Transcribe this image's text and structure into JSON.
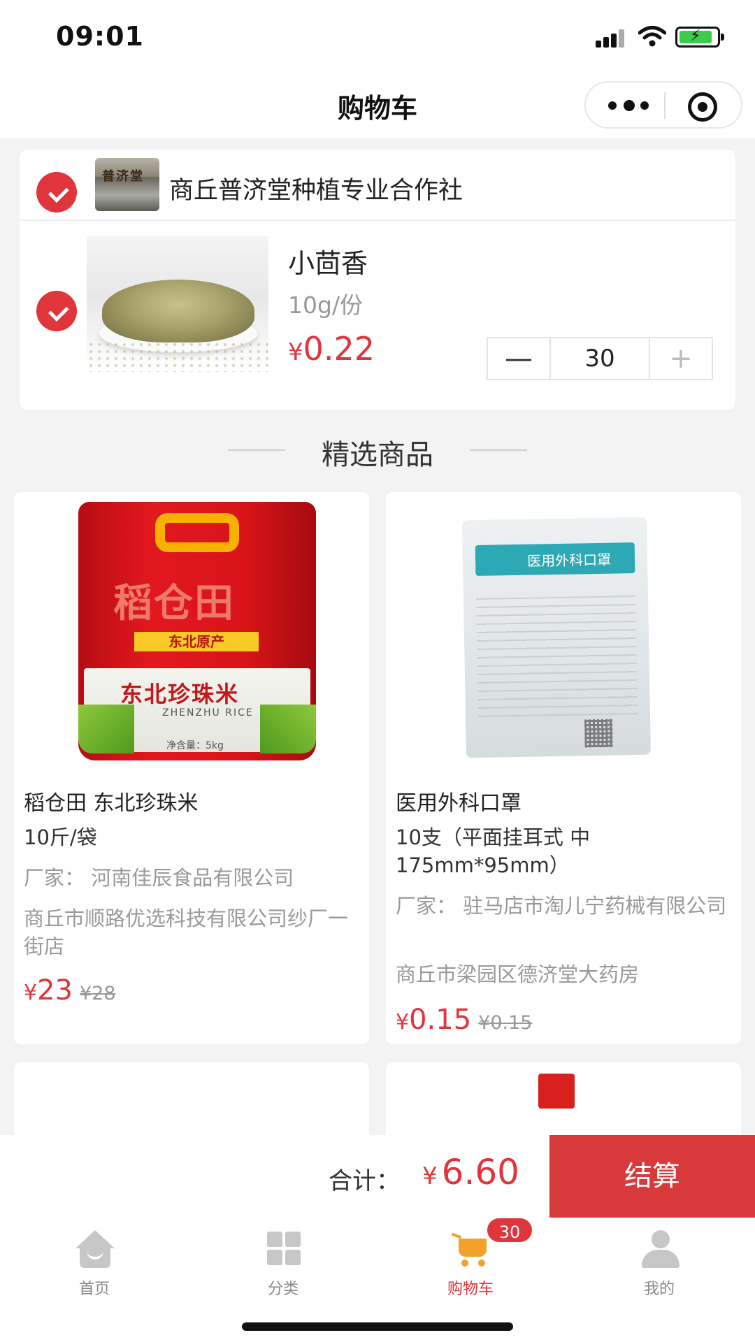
{
  "status_bar": {
    "time": "09:01"
  },
  "nav": {
    "title": "购物车"
  },
  "cart": {
    "store_name": "商丘普济堂种植专业合作社",
    "store_logo_text": "普济堂",
    "item": {
      "name": "小茴香",
      "spec": "10g/份",
      "currency": "¥",
      "price": "0.22",
      "quantity": "30",
      "minus": "—",
      "plus": "+"
    }
  },
  "section": {
    "title": "精选商品"
  },
  "products": [
    {
      "name": "稻仓田 东北珍珠米",
      "spec": "10斤/袋",
      "maker": "厂家：  河南佳辰食品有限公司",
      "shop": "商丘市顺路优选科技有限公司纱厂一街店",
      "currency": "¥",
      "price": "23",
      "old_price": "¥28",
      "image_text": {
        "brand": "稻仓田",
        "origin": "东北原产",
        "product": "东北珍珠米",
        "english": "ZHENZHU RICE",
        "net": "净含量：5kg"
      }
    },
    {
      "name": "医用外科口罩",
      "spec": "10支（平面挂耳式 中 175mm*95mm）",
      "maker": "厂家：  驻马店市淘儿宁药械有限公司",
      "shop": "商丘市梁园区德济堂大药房",
      "currency": "¥",
      "price": "0.15",
      "old_price": "¥0.15",
      "image_text": {
        "label": "医用外科口罩"
      }
    }
  ],
  "checkout": {
    "total_label": "合计：",
    "currency": "¥",
    "total": "6.60",
    "button": "结算"
  },
  "tabs": [
    {
      "label": "首页",
      "icon": "home-icon"
    },
    {
      "label": "分类",
      "icon": "grid-icon"
    },
    {
      "label": "购物车",
      "icon": "cart-icon",
      "badge": "30",
      "active": true
    },
    {
      "label": "我的",
      "icon": "user-icon"
    }
  ],
  "colors": {
    "accent": "#e0353a",
    "checkout_button": "#d8393b",
    "cart_icon": "#f3a12b"
  }
}
